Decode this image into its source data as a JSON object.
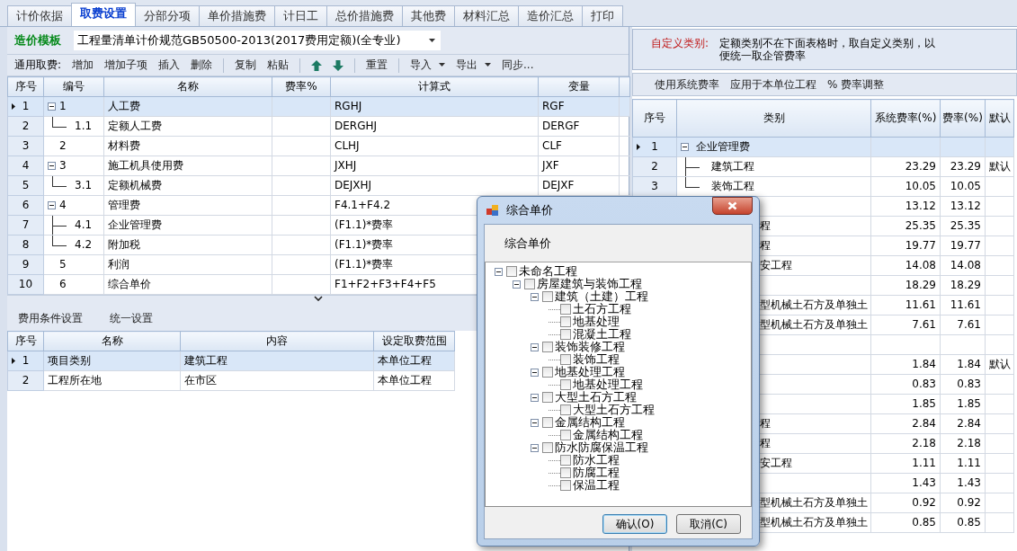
{
  "tabs": [
    {
      "label": "计价依据",
      "selected": false
    },
    {
      "label": "取费设置",
      "selected": true
    },
    {
      "label": "分部分项",
      "selected": false
    },
    {
      "label": "单价措施费",
      "selected": false
    },
    {
      "label": "计日工",
      "selected": false
    },
    {
      "label": "总价措施费",
      "selected": false
    },
    {
      "label": "其他费",
      "selected": false
    },
    {
      "label": "材料汇总",
      "selected": false
    },
    {
      "label": "造价汇总",
      "selected": false
    },
    {
      "label": "打印",
      "selected": false
    }
  ],
  "template": {
    "label": "造价模板",
    "value": "工程量清单计价规范GB50500-2013(2017费用定额)(全专业)"
  },
  "toolbar": {
    "label": "通用取费:",
    "groups": [
      [
        {
          "kind": "text",
          "label": "增加"
        },
        {
          "kind": "text",
          "label": "增加子项"
        },
        {
          "kind": "text",
          "label": "插入"
        },
        {
          "kind": "text",
          "label": "删除"
        }
      ],
      [
        {
          "kind": "text",
          "label": "复制"
        },
        {
          "kind": "text",
          "label": "粘贴"
        }
      ],
      [
        {
          "kind": "up"
        },
        {
          "kind": "down"
        }
      ],
      [
        {
          "kind": "text",
          "label": "重置"
        }
      ],
      [
        {
          "kind": "dropdown",
          "label": "导入"
        },
        {
          "kind": "dropdown",
          "label": "导出"
        },
        {
          "kind": "text",
          "label": "同步..."
        }
      ]
    ]
  },
  "fee_table": {
    "columns": [
      "序号",
      "编号",
      "名称",
      "费率%",
      "计算式",
      "变量"
    ],
    "rows": [
      {
        "seq": "1",
        "code": "1",
        "name": "人工费",
        "formula": "RGHJ",
        "variable": "RGF",
        "selected": true,
        "expanded": true,
        "children": [
          {
            "seq": "2",
            "code": "1.1",
            "name": "定额人工费",
            "formula": "DERGHJ",
            "variable": "DERGF",
            "selected": false
          }
        ]
      },
      {
        "seq": "3",
        "code": "2",
        "name": "材料费",
        "formula": "CLHJ",
        "variable": "CLF",
        "selected": false
      },
      {
        "seq": "4",
        "code": "3",
        "name": "施工机具使用费",
        "formula": "JXHJ",
        "variable": "JXF",
        "selected": false,
        "expanded": true,
        "children": [
          {
            "seq": "5",
            "code": "3.1",
            "name": "定额机械费",
            "formula": "DEJXHJ",
            "variable": "DEJXF",
            "selected": false
          }
        ]
      },
      {
        "seq": "6",
        "code": "4",
        "name": "管理费",
        "formula": "F4.1+F4.2",
        "selected": false,
        "expanded": true,
        "children": [
          {
            "seq": "7",
            "code": "4.1",
            "name": "企业管理费",
            "formula": "(F1.1)*费率",
            "selected": false
          },
          {
            "seq": "8",
            "code": "4.2",
            "name": "附加税",
            "formula": "(F1.1)*费率",
            "selected": false
          }
        ]
      },
      {
        "seq": "9",
        "code": "5",
        "name": "利润",
        "formula": "(F1.1)*费率",
        "selected": false
      },
      {
        "seq": "10",
        "code": "6",
        "name": "综合单价",
        "formula": "F1+F2+F3+F4+F5",
        "selected": false
      }
    ]
  },
  "condition_toolbar": [
    "费用条件设置",
    "统一设置"
  ],
  "condition_table": {
    "columns": [
      "序号",
      "名称",
      "内容",
      "设定取费范围"
    ],
    "rows": [
      {
        "seq": "1",
        "name": "项目类别",
        "content": "建筑工程",
        "scope": "本单位工程",
        "selected": true
      },
      {
        "seq": "2",
        "name": "工程所在地",
        "content": "在市区",
        "scope": "本单位工程",
        "selected": false
      }
    ]
  },
  "custom_category": {
    "label": "自定义类别:",
    "text": "定额类别不在下面表格时，取自定义类别，以便统一取企管费率"
  },
  "rate_toolbar": [
    "使用系统费率",
    "应用于本单位工程",
    "% 费率调整"
  ],
  "rate_table": {
    "columns": [
      "序号",
      "类别",
      "系统费率(%)",
      "费率(%)",
      "默认"
    ],
    "rows": [
      {
        "kind": "group",
        "seq": "1",
        "category": "企业管理费",
        "selected": true,
        "expanded": true,
        "children": [
          {
            "kind": "item",
            "seq": "2",
            "category": "建筑工程",
            "sys_rate": "23.29",
            "rate": "23.29",
            "default": "默认",
            "selected": false
          },
          {
            "kind": "item",
            "seq": "3",
            "category": "装饰工程",
            "sys_rate": "10.05",
            "rate": "10.05",
            "selected": false
          }
        ]
      },
      {
        "kind": "clipped",
        "sys_rate": "13.12",
        "rate": "13.12",
        "selected": false
      },
      {
        "kind": "clipped",
        "category": "程",
        "sys_rate": "25.35",
        "rate": "25.35",
        "selected": false
      },
      {
        "kind": "clipped",
        "category": "程",
        "sys_rate": "19.77",
        "rate": "19.77",
        "selected": false
      },
      {
        "kind": "clipped",
        "category": "安工程",
        "sys_rate": "14.08",
        "rate": "14.08",
        "selected": false
      },
      {
        "kind": "clipped",
        "sys_rate": "18.29",
        "rate": "18.29",
        "selected": false
      },
      {
        "kind": "clipped",
        "category": "型机械土石方及单独土",
        "sys_rate": "11.61",
        "rate": "11.61",
        "selected": false
      },
      {
        "kind": "clipped",
        "category": "型机械土石方及单独土",
        "sys_rate": "7.61",
        "rate": "7.61",
        "selected": false
      },
      {
        "kind": "clipped",
        "selected": false
      },
      {
        "kind": "clipped",
        "sys_rate": "1.84",
        "rate": "1.84",
        "default": "默认",
        "selected": false
      },
      {
        "kind": "clipped",
        "sys_rate": "0.83",
        "rate": "0.83",
        "selected": false
      },
      {
        "kind": "clipped",
        "sys_rate": "1.85",
        "rate": "1.85",
        "selected": false
      },
      {
        "kind": "clipped",
        "category": "程",
        "sys_rate": "2.84",
        "rate": "2.84",
        "selected": false
      },
      {
        "kind": "clipped",
        "category": "程",
        "sys_rate": "2.18",
        "rate": "2.18",
        "selected": false
      },
      {
        "kind": "clipped",
        "category": "安工程",
        "sys_rate": "1.11",
        "rate": "1.11",
        "selected": false
      },
      {
        "kind": "clipped",
        "sys_rate": "1.43",
        "rate": "1.43",
        "selected": false
      },
      {
        "kind": "clipped",
        "category": "型机械土石方及单独土",
        "sys_rate": "0.92",
        "rate": "0.92",
        "selected": false
      },
      {
        "kind": "clipped",
        "category": "型机械土石方及单独土",
        "sys_rate": "0.85",
        "rate": "0.85",
        "selected": false
      }
    ]
  },
  "dialog": {
    "title": "综合单价",
    "heading": "综合单价",
    "tree": [
      {
        "label": "未命名工程",
        "checked": false,
        "expanded": true,
        "children": [
          {
            "label": "房屋建筑与装饰工程",
            "checked": false,
            "expanded": true,
            "children": [
              {
                "label": "建筑（土建）工程",
                "checked": false,
                "expanded": true,
                "children": [
                  {
                    "label": "土石方工程",
                    "checked": false
                  },
                  {
                    "label": "地基处理",
                    "checked": false
                  },
                  {
                    "label": "混凝土工程",
                    "checked": false
                  }
                ]
              },
              {
                "label": "装饰装修工程",
                "checked": false,
                "expanded": true,
                "children": [
                  {
                    "label": "装饰工程",
                    "checked": false
                  }
                ]
              },
              {
                "label": "地基处理工程",
                "checked": false,
                "expanded": true,
                "children": [
                  {
                    "label": "地基处理工程",
                    "checked": false
                  }
                ]
              },
              {
                "label": "大型土石方工程",
                "checked": false,
                "expanded": true,
                "children": [
                  {
                    "label": "大型土石方工程",
                    "checked": false
                  }
                ]
              },
              {
                "label": "金属结构工程",
                "checked": false,
                "expanded": true,
                "children": [
                  {
                    "label": "金属结构工程",
                    "checked": false
                  }
                ]
              },
              {
                "label": "防水防腐保温工程",
                "checked": false,
                "expanded": true,
                "children": [
                  {
                    "label": "防水工程",
                    "checked": false
                  },
                  {
                    "label": "防腐工程",
                    "checked": false
                  },
                  {
                    "label": "保温工程",
                    "checked": false
                  }
                ]
              }
            ]
          }
        ]
      }
    ],
    "buttons": [
      {
        "label": "确认(O)",
        "default": true
      },
      {
        "label": "取消(C)",
        "default": false
      }
    ]
  }
}
